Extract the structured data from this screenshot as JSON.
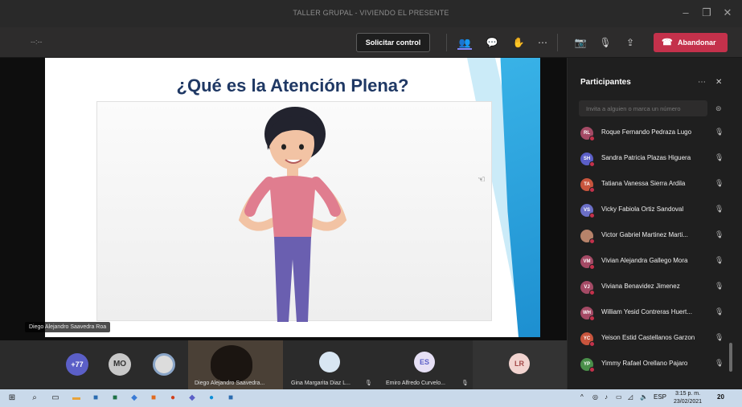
{
  "window": {
    "title": "TALLER GRUPAL - VIVIENDO EL PRESENTE"
  },
  "toolbar": {
    "timer": "--:--",
    "request_control": "Solicitar control",
    "leave": "Abandonar"
  },
  "slide": {
    "title": "¿Qué es la Atención Plena?"
  },
  "presenter": {
    "name": "Diego Alejandro Saavedra Roa"
  },
  "strip": {
    "overflow_count": "+77",
    "tiles": [
      {
        "initials": "MO",
        "name": ""
      },
      {
        "initials": "",
        "name": ""
      },
      {
        "initials": "",
        "name": "Diego Alejandro Saavedra..."
      },
      {
        "initials": "",
        "name": "Gina Margarita Diaz L..."
      },
      {
        "initials": "ES",
        "name": "Emiro Alfredo Curvelo..."
      },
      {
        "initials": "LR",
        "name": ""
      }
    ]
  },
  "panel": {
    "title": "Participantes",
    "invite_placeholder": "Invita a alguien o marca un número",
    "participants": [
      {
        "initials": "RL",
        "name": "Roque Fernando Pedraza Lugo",
        "color": "#a44a65"
      },
      {
        "initials": "SH",
        "name": "Sandra Patricia Plazas Higuera",
        "color": "#5b5fc7"
      },
      {
        "initials": "TA",
        "name": "Tatiana Vanessa Sierra Ardila",
        "color": "#c8553d"
      },
      {
        "initials": "VS",
        "name": "Vicky Fabiola Ortiz Sandoval",
        "color": "#6b6fc7"
      },
      {
        "initials": "",
        "name": "Victor Gabriel Martinez Marti...",
        "color": "#b7836a"
      },
      {
        "initials": "VM",
        "name": "Vivian Alejandra Gallego Mora",
        "color": "#a44a65"
      },
      {
        "initials": "VJ",
        "name": "Viviana Benavidez Jimenez",
        "color": "#a44a65"
      },
      {
        "initials": "WH",
        "name": "William Yesid Contreras Huert...",
        "color": "#a44a65"
      },
      {
        "initials": "YC",
        "name": "Yeison Estid Castellanos Garzon",
        "color": "#c8553d"
      },
      {
        "initials": "YP",
        "name": "Yimmy Rafael Orellano Pajaro",
        "color": "#4a8f4a"
      }
    ]
  },
  "taskbar": {
    "lang": "ESP",
    "time": "3:15 p. m.",
    "date": "23/02/2021",
    "notifications": "20"
  }
}
